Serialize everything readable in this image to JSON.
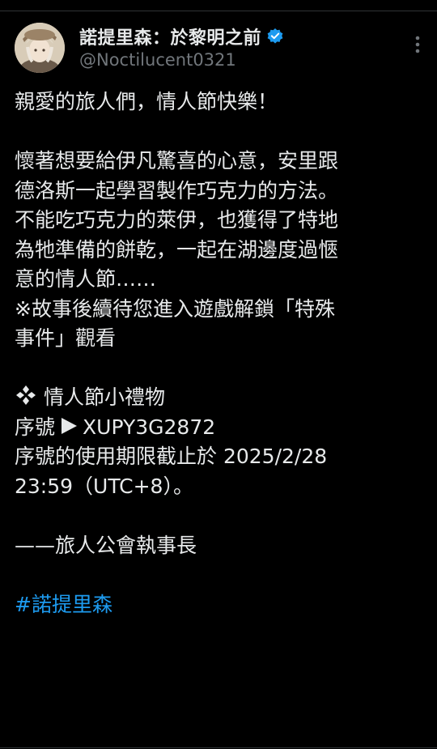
{
  "author": {
    "display_name": "諾提里森：於黎明之前",
    "handle": "@Noctilucent0321",
    "verified": true,
    "verified_color": "#1d9bf0",
    "avatar_icon": "character-avatar"
  },
  "menu": {
    "more_icon": "more-vertical-icon"
  },
  "body": {
    "greeting": "親愛的旅人們，情人節快樂！",
    "story_lines": [
      "懷著想要給伊凡驚喜的心意，安里跟",
      "德洛斯一起學習製作巧克力的方法。",
      "不能吃巧克力的萊伊，也獲得了特地",
      "為牠準備的餅乾，一起在湖邊度過愜",
      "意的情人節……",
      "※故事後續待您進入遊戲解鎖「特殊",
      "事件」觀看"
    ],
    "gift": {
      "title": "情人節小禮物",
      "serial_label": "序號",
      "serial_code": "XUPY3G2872",
      "expiry_line_1": "序號的使用期限截止於 2025/2/28",
      "expiry_line_2": "23:59（UTC+8）。"
    },
    "signature": "——旅人公會執事長",
    "hashtag": "#諾提里森"
  },
  "colors": {
    "background": "#000000",
    "text": "#e7e9ea",
    "secondary_text": "#71767b",
    "link": "#1d9bf0"
  }
}
